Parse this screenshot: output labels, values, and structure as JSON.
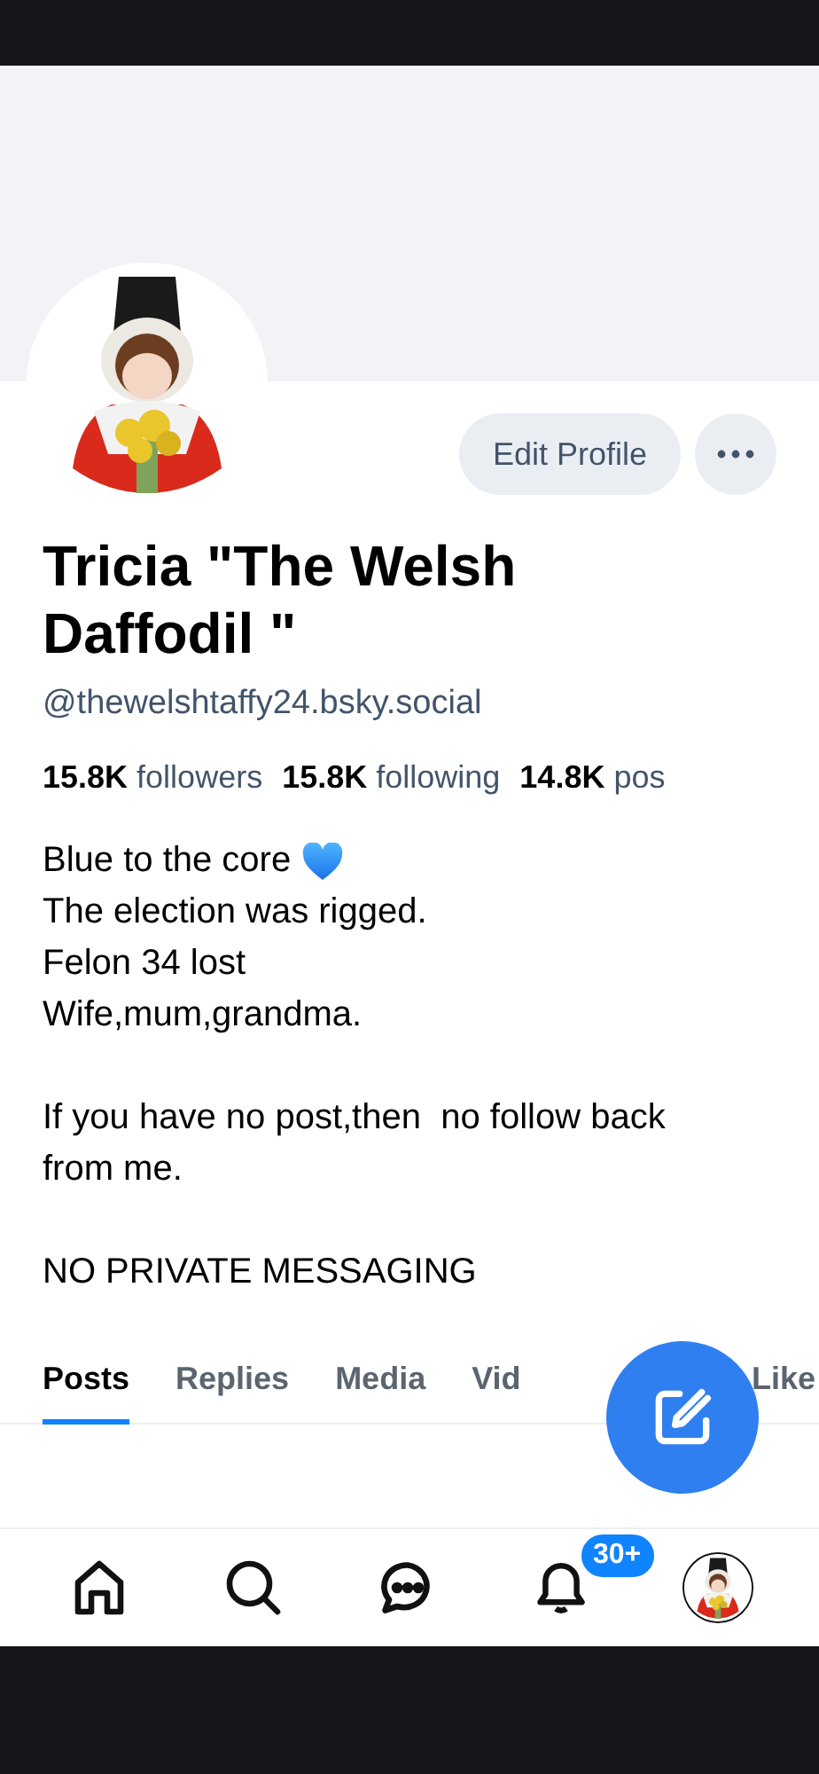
{
  "profile": {
    "name": "Tricia \"The Welsh Daffodil \"",
    "handle": "@thewelshtaffy24.bsky.social"
  },
  "actions": {
    "edit_label": "Edit Profile"
  },
  "stats": [
    {
      "text": "**15.8K** followers"
    },
    {
      "text": "**15.8K** following"
    },
    {
      "text": "**14.8K** pos"
    }
  ],
  "bio": [
    {
      "kind": "heart-line",
      "text": "Blue to the core"
    },
    {
      "kind": "line",
      "text": "The election was rigged."
    },
    {
      "kind": "line",
      "text": "Felon 34 lost"
    },
    {
      "kind": "line",
      "text": "Wife,mum,grandma."
    },
    {
      "kind": "gap"
    },
    {
      "kind": "line",
      "text": "If you have no post,then  no follow back from me."
    },
    {
      "kind": "gap"
    },
    {
      "kind": "line",
      "text": "NO PRIVATE MESSAGING"
    }
  ],
  "tabs": [
    {
      "label": "Posts",
      "selected": true
    },
    {
      "label": "Replies",
      "selected": false
    },
    {
      "label": "Media",
      "selected": false
    },
    {
      "label": "Vid",
      "selected": false
    },
    {
      "label": "Like",
      "selected": false
    }
  ],
  "nav": [
    {
      "kind": "home"
    },
    {
      "kind": "search"
    },
    {
      "kind": "chat"
    },
    {
      "kind": "bell",
      "badge": "30+"
    },
    {
      "kind": "avatar"
    }
  ]
}
